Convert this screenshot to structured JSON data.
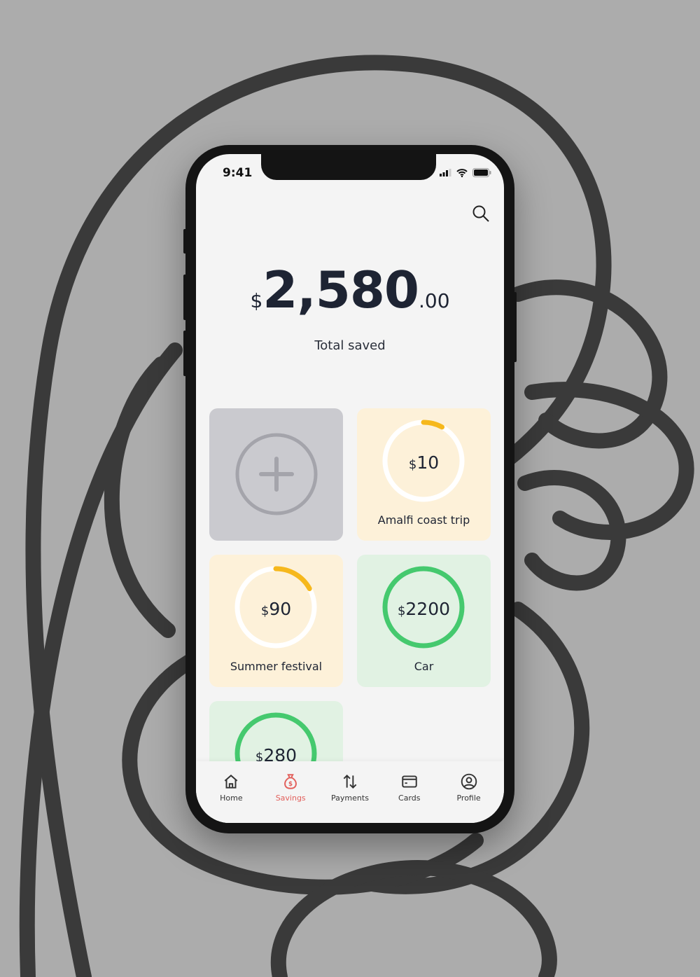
{
  "status": {
    "time": "9:41"
  },
  "summary": {
    "currency": "$",
    "amount": "2,580",
    "cents": ".00",
    "label": "Total saved"
  },
  "colors": {
    "accent": "#e2605c",
    "yellow": "#f6b81c",
    "green": "#45c96e",
    "yellowCard": "#fdf1d9",
    "greenCard": "#e1f2e3",
    "addCard": "#cacacf"
  },
  "goals": [
    {
      "amount": "10",
      "name": "Amalfi coast trip",
      "progress": 0.08,
      "color": "yellow"
    },
    {
      "amount": "90",
      "name": "Summer festival",
      "progress": 0.17,
      "color": "yellow"
    },
    {
      "amount": "2200",
      "name": "Car",
      "progress": 1.0,
      "color": "green"
    },
    {
      "amount": "280",
      "name": "",
      "progress": 1.0,
      "color": "green"
    }
  ],
  "nav": [
    {
      "label": "Home",
      "icon": "home-icon"
    },
    {
      "label": "Savings",
      "icon": "money-bag-icon",
      "active": true
    },
    {
      "label": "Payments",
      "icon": "transfer-arrows-icon"
    },
    {
      "label": "Cards",
      "icon": "card-icon"
    },
    {
      "label": "Profile",
      "icon": "profile-icon"
    }
  ]
}
